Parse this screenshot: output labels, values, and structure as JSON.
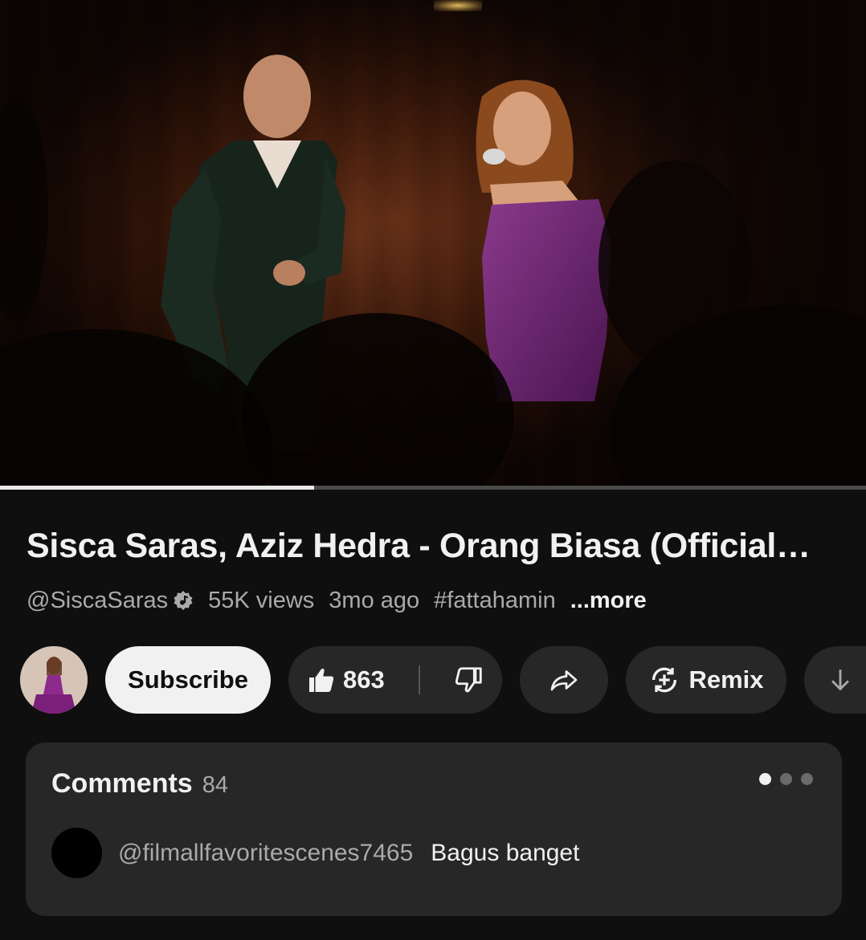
{
  "video": {
    "progress_fraction": 0.363
  },
  "title": "Sisca Saras, Aziz Hedra - Orang Biasa (Official…",
  "meta": {
    "channel": "@SiscaSaras",
    "views": "55K views",
    "age": "3mo ago",
    "hashtag": "#fattahamin",
    "more": "...more"
  },
  "actions": {
    "subscribe": "Subscribe",
    "like_count": "863",
    "remix": "Remix"
  },
  "comments": {
    "title": "Comments",
    "count": "84",
    "page_dots": 3,
    "active_dot": 0,
    "top_comment": {
      "user": "@filmallfavoritescenes7465",
      "text": "Bagus banget"
    }
  },
  "colors": {
    "background": "#0f0f0f",
    "surface": "#272727",
    "text_primary": "#f1f1f1",
    "text_secondary": "#aaaaaa",
    "dress_purple": "#6b1f6e"
  }
}
